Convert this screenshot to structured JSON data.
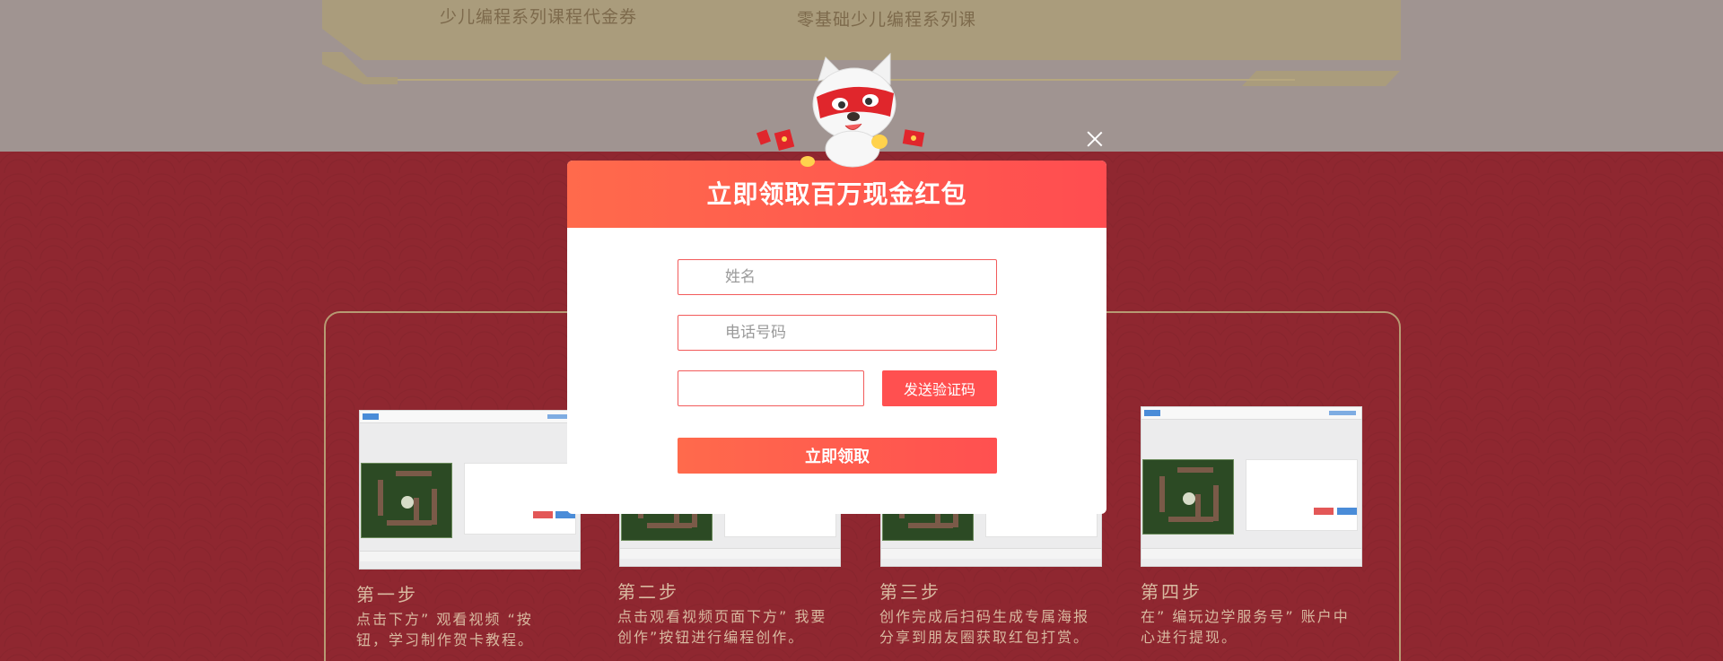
{
  "coupons": {
    "title_1": "少儿编程系列课程代金券",
    "title_2": "零基础少儿编程系列课"
  },
  "steps": [
    {
      "title": "第一步",
      "desc_line1": "点击下方” 观看视频 “按",
      "desc_line2": "钮，学习制作贺卡教程。"
    },
    {
      "title": "第二步",
      "desc_line1": "点击观看视频页面下方” 我要",
      "desc_line2": "创作”按钮进行编程创作。"
    },
    {
      "title": "第三步",
      "desc_line1": "创作完成后扫码生成专属海报",
      "desc_line2": "分享到朋友圈获取红包打赏。"
    },
    {
      "title": "第四步",
      "desc_line1": "在” 编玩边学服务号” 账户中",
      "desc_line2": "心进行提现。"
    }
  ],
  "modal": {
    "title": "立即领取百万现金红包",
    "name_placeholder": "姓名",
    "phone_placeholder": "电话号码",
    "code_value": "",
    "send_code_label": "发送验证码",
    "submit_label": "立即领取"
  },
  "icons": {
    "close": "close-icon",
    "mascot": "dog-mascot",
    "red_envelope": "red-envelope-icon"
  },
  "colors": {
    "header_start": "#ff6a4c",
    "header_end": "#ff4d50",
    "button": "#ff5050",
    "field_border": "#f25b5b",
    "page_red": "#8f2730"
  }
}
